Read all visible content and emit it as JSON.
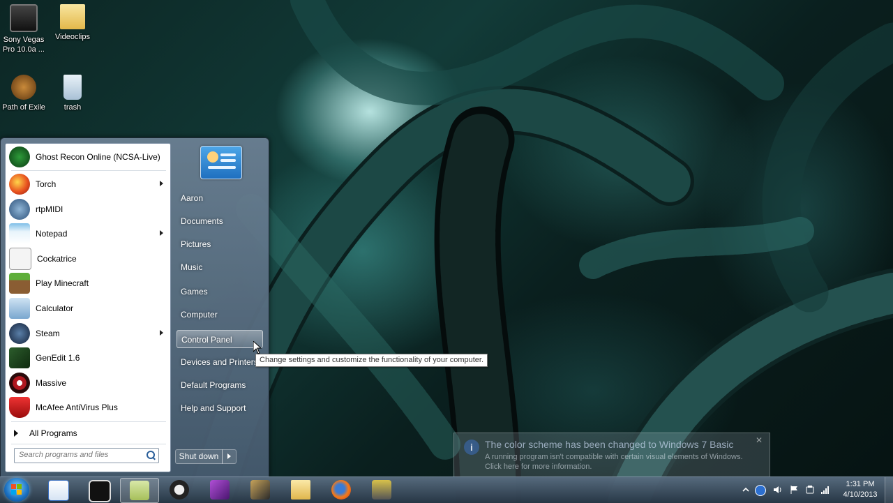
{
  "desktop": {
    "icons": [
      {
        "label": "Sony Vegas Pro 10.0a ...",
        "icon": "sony-vegas-icon"
      },
      {
        "label": "Videoclips",
        "icon": "folder-icon"
      },
      {
        "label": "Path of Exile",
        "icon": "path-of-exile-icon"
      },
      {
        "label": "trash",
        "icon": "recycle-bin-icon"
      }
    ]
  },
  "start_menu": {
    "programs": [
      {
        "label": "Ghost Recon Online (NCSA-Live)",
        "icon": "ghost-recon-icon",
        "submenu": false
      },
      {
        "label": "Torch",
        "icon": "torch-browser-icon",
        "submenu": true
      },
      {
        "label": "rtpMIDI",
        "icon": "rtpmidi-icon",
        "submenu": false
      },
      {
        "label": "Notepad",
        "icon": "notepad-icon",
        "submenu": true
      },
      {
        "label": "Cockatrice",
        "icon": "cockatrice-icon",
        "submenu": false
      },
      {
        "label": "Play Minecraft",
        "icon": "minecraft-icon",
        "submenu": false
      },
      {
        "label": "Calculator",
        "icon": "calculator-icon",
        "submenu": false
      },
      {
        "label": "Steam",
        "icon": "steam-icon",
        "submenu": true
      },
      {
        "label": "GenEdit 1.6",
        "icon": "genedit-icon",
        "submenu": false
      },
      {
        "label": "Massive",
        "icon": "massive-icon",
        "submenu": false
      },
      {
        "label": "McAfee AntiVirus Plus",
        "icon": "mcafee-icon",
        "submenu": false
      }
    ],
    "all_programs": "All Programs",
    "search_placeholder": "Search programs and files",
    "right_items": [
      {
        "label": "Aaron"
      },
      {
        "label": "Documents"
      },
      {
        "label": "Pictures"
      },
      {
        "label": "Music"
      },
      {
        "label": "Games"
      },
      {
        "label": "Computer"
      },
      {
        "label": "Control Panel",
        "highlighted": true
      },
      {
        "label": "Devices and Printers"
      },
      {
        "label": "Default Programs"
      },
      {
        "label": "Help and Support"
      }
    ],
    "shutdown_label": "Shut down"
  },
  "tooltip": "Change settings and customize the functionality of your computer.",
  "notification": {
    "title": "The color scheme has been changed to Windows 7 Basic",
    "line1": "A running program isn't compatible with certain visual elements of Windows.",
    "line2": "Click here for more information."
  },
  "taskbar": {
    "pinned": [
      "mixcraft-icon",
      "live-icon",
      "notepad-icon",
      "epic-icon",
      "app-3-icon",
      "media-icon",
      "explorer-folder-icon",
      "firefox-icon",
      "projector-icon"
    ],
    "clock_time": "1:31 PM",
    "clock_date": "4/10/2013"
  },
  "colors": {
    "menu_bg": "#6e8296",
    "accent_blue": "#1f6fbf",
    "wallpaper_teal": "#123b38"
  }
}
